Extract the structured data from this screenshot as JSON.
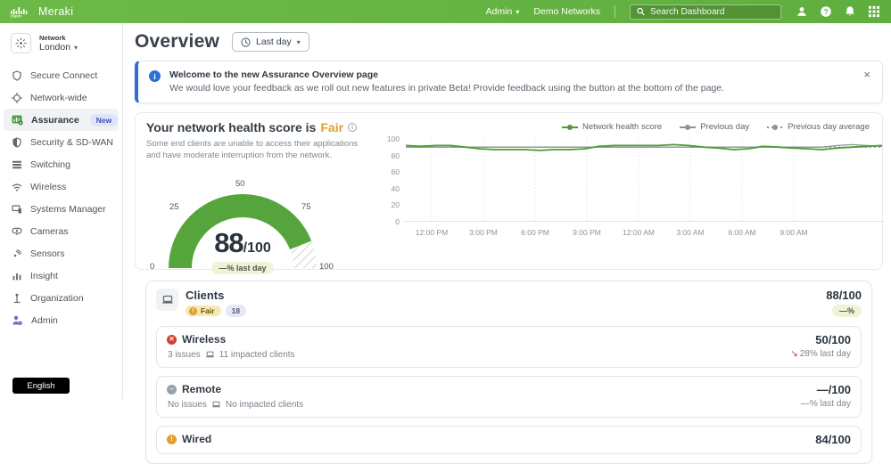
{
  "colors": {
    "topbar_green": "#67b445",
    "accent_blue": "#2e6fd6",
    "fair_orange": "#df9f2b",
    "gauge_green": "#56a43c",
    "error_red": "#cf3f34",
    "line_green": "#4e9d33",
    "line_gray": "#8d939a"
  },
  "topbar": {
    "brand": "Meraki",
    "admin_label": "Admin",
    "org_label": "Demo Networks",
    "search_placeholder": "Search Dashboard"
  },
  "sidebar": {
    "network_label": "Network",
    "network_value": "London",
    "items": [
      {
        "icon": "shield-icon",
        "label": "Secure Connect"
      },
      {
        "icon": "crosshair-icon",
        "label": "Network-wide"
      },
      {
        "icon": "assurance-chart-icon",
        "label": "Assurance",
        "badge": "New"
      },
      {
        "icon": "security-shield-icon",
        "label": "Security & SD-WAN"
      },
      {
        "icon": "switch-stack-icon",
        "label": "Switching"
      },
      {
        "icon": "wifi-icon",
        "label": "Wireless"
      },
      {
        "icon": "devices-icon",
        "label": "Systems Manager"
      },
      {
        "icon": "camera-icon",
        "label": "Cameras"
      },
      {
        "icon": "sensor-icon",
        "label": "Sensors"
      },
      {
        "icon": "bar-chart-icon",
        "label": "Insight"
      },
      {
        "icon": "organization-icon",
        "label": "Organization"
      },
      {
        "icon": "admin-person-gear-icon",
        "label": "Admin"
      }
    ],
    "language": "English"
  },
  "page": {
    "title": "Overview",
    "range_label": "Last day"
  },
  "banner": {
    "title": "Welcome to the new Assurance Overview page",
    "body": "We would love your feedback as we roll out new features in private Beta! Provide feedback using the button at the bottom of the page.",
    "close": "×"
  },
  "health": {
    "title_prefix": "Your network health score is",
    "rating": "Fair",
    "description": "Some end clients are unable to access their applications and have moderate interruption from the network.",
    "gauge": {
      "value": "88",
      "max_label": "/100",
      "delta_label": "—% last day",
      "ticks": [
        "0",
        "25",
        "50",
        "75",
        "100"
      ]
    }
  },
  "chart_data": {
    "type": "line",
    "title": "Network health score over last day",
    "x_range": "last 24 hours",
    "x_tick_labels": [
      "12:00 PM",
      "3:00 PM",
      "6:00 PM",
      "9:00 PM",
      "12:00 AM",
      "3:00 AM",
      "6:00 AM",
      "9:00 AM"
    ],
    "y_ticks": [
      0,
      20,
      40,
      60,
      80,
      100
    ],
    "ylim": [
      0,
      100
    ],
    "grid": "vertical-dotted",
    "legend_position": "top-right",
    "series": [
      {
        "name": "Network health score",
        "color": "#4e9d33",
        "style": "solid",
        "values": [
          91,
          90,
          91,
          91,
          89,
          87,
          86,
          86,
          86,
          85,
          86,
          86,
          87,
          90,
          91,
          91,
          91,
          91,
          92,
          91,
          89,
          88,
          86,
          87,
          90,
          89,
          88,
          87,
          86,
          88,
          89,
          90,
          91
        ]
      },
      {
        "name": "Previous day",
        "color": "#8d939a",
        "style": "solid",
        "values": [
          89,
          89,
          89,
          89,
          89,
          89,
          89,
          89,
          89,
          89,
          89,
          89,
          89,
          89,
          89,
          89,
          89,
          89,
          89,
          89,
          89,
          89,
          89,
          89,
          89,
          89,
          89,
          89,
          89,
          91,
          92,
          91,
          90
        ]
      },
      {
        "name": "Previous day average",
        "color": "#8d939a",
        "style": "dotted",
        "values": [
          89,
          89,
          89,
          89,
          89,
          89,
          89,
          89,
          89,
          89,
          89,
          89,
          89,
          89,
          89,
          89,
          89,
          89,
          89,
          89,
          89,
          89,
          89,
          89,
          89,
          89,
          89,
          89,
          89,
          89,
          89,
          89,
          89
        ]
      }
    ]
  },
  "clients": {
    "title": "Clients",
    "rating": "Fair",
    "count": "18",
    "score": "88/100",
    "delta": "—%",
    "rows": [
      {
        "status": "error",
        "name": "Wireless",
        "issues": "3 issues",
        "impacted": "11 impacted clients",
        "score": "50/100",
        "delta": "28% last day",
        "trend": "down"
      },
      {
        "status": "neutral",
        "name": "Remote",
        "issues": "No issues",
        "impacted": "No impacted clients",
        "score": "—/100",
        "delta": "—% last day",
        "trend": "flat"
      },
      {
        "status": "warning",
        "name": "Wired",
        "score": "84/100"
      }
    ]
  }
}
